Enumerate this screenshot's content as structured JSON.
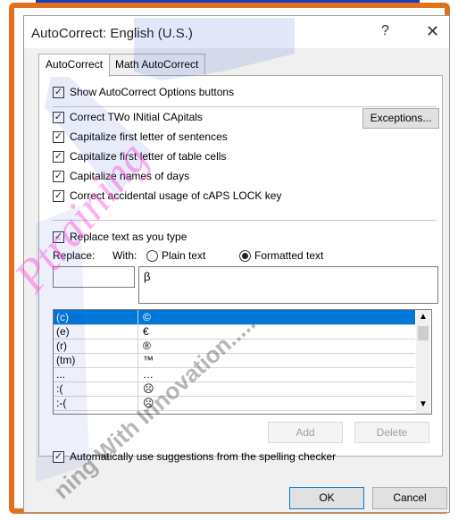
{
  "window": {
    "title": "AutoCorrect: English (U.S.)",
    "help_label": "?",
    "close_label": "✕"
  },
  "tabs": [
    {
      "label": "AutoCorrect"
    },
    {
      "label": "Math AutoCorrect"
    }
  ],
  "options": {
    "show_buttons": "Show AutoCorrect Options buttons",
    "correct_two": "Correct TWo INitial CApitals",
    "cap_sentences": "Capitalize first letter of sentences",
    "cap_cells": "Capitalize first letter of table cells",
    "cap_days": "Capitalize names of days",
    "caps_lock": "Correct accidental usage of cAPS LOCK key",
    "replace_text": "Replace text as you type",
    "auto_suggest": "Automatically use suggestions from the spelling checker"
  },
  "checkmark": "✓",
  "exceptions_label": "Exceptions...",
  "replace_label": "Replace:",
  "with_label": "With:",
  "plain_text_label": "Plain text",
  "formatted_text_label": "Formatted text",
  "replace_value": "",
  "with_value": "β",
  "entries": [
    {
      "replace": "(c)",
      "with": "©"
    },
    {
      "replace": "(e)",
      "with": "€"
    },
    {
      "replace": "(r)",
      "with": "®"
    },
    {
      "replace": "(tm)",
      "with": "™"
    },
    {
      "replace": "...",
      "with": "…"
    },
    {
      "replace": ":(",
      "with": "☹"
    },
    {
      "replace": ":-(",
      "with": "☹"
    }
  ],
  "add_label": "Add",
  "delete_label": "Delete",
  "ok_label": "OK",
  "cancel_label": "Cancel",
  "scroll_up": "▲",
  "scroll_down": "▼",
  "watermark": {
    "line1": "ning With Innovation.....",
    "line2": "Ptraining"
  },
  "colors": {
    "frame": "#e2701c",
    "selection": "#0078d7",
    "watermark_blue": "#1c45c8",
    "watermark_pink": "#ff4fd8"
  }
}
